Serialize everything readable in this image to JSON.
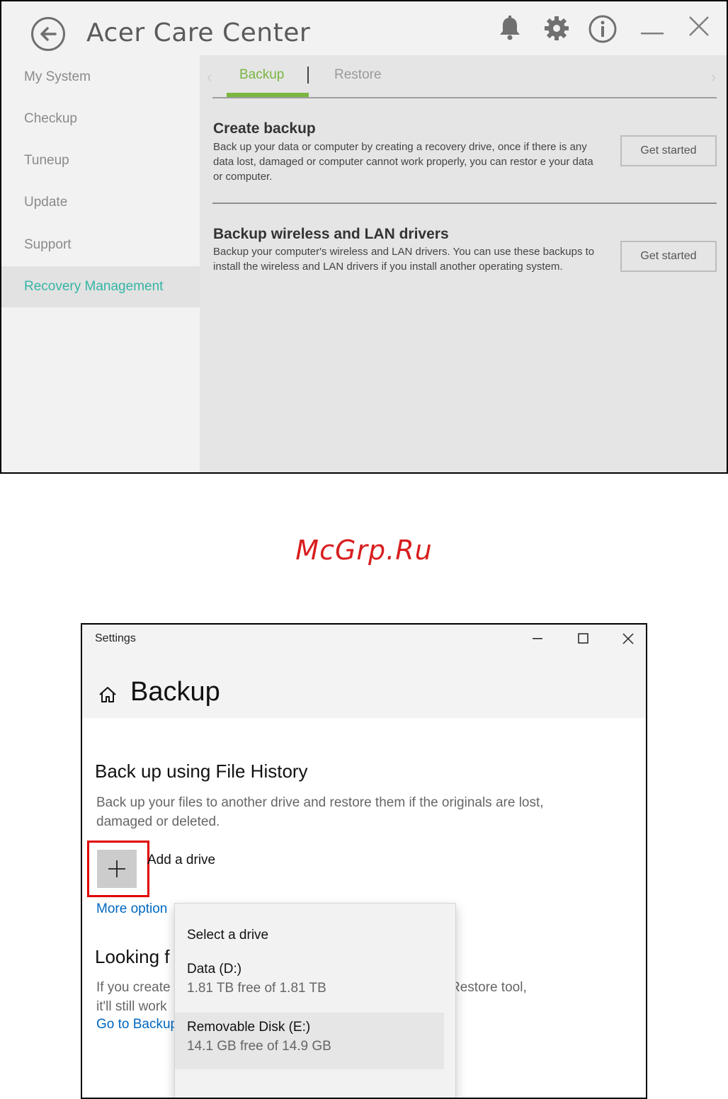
{
  "acer": {
    "title": "Acer Care Center",
    "sidebar": [
      {
        "label": "My System",
        "active": false
      },
      {
        "label": "Checkup",
        "active": false
      },
      {
        "label": "Tuneup",
        "active": false
      },
      {
        "label": "Update",
        "active": false
      },
      {
        "label": "Support",
        "active": false
      },
      {
        "label": "Recovery Management",
        "active": true
      }
    ],
    "tabs": [
      {
        "label": "Backup",
        "active": true
      },
      {
        "label": "Restore",
        "active": false
      }
    ],
    "sections": [
      {
        "title": "Create backup",
        "description": "Back up your data or computer by creating a recovery drive, once if there is  any data lost, damaged or computer cannot work properly, you can restor e your data or computer.",
        "button": "Get started"
      },
      {
        "title": "Backup wireless and LAN drivers",
        "description": "Backup your computer's wireless and LAN drivers. You can use these backups to install the wireless and LAN drivers if you install another operating system.",
        "button": "Get started"
      }
    ],
    "colors": {
      "accent": "#35b5a4",
      "tab_accent": "#7ab640"
    }
  },
  "watermark": "McGrp.Ru",
  "settings": {
    "app_title": "Settings",
    "page_title": "Backup",
    "file_history": {
      "title": "Back up using File History",
      "description": "Back up your files to another drive and restore them if the originals are lost, damaged or deleted.",
      "add_drive_label": "Add a drive",
      "more_options_link": "More option"
    },
    "looking": {
      "title": "Looking f",
      "line1": "If you create",
      "line2": "it'll still work",
      "line1_right": "Restore tool,",
      "link": "Go to Backup"
    },
    "drive_picker": {
      "title": "Select a drive",
      "drives": [
        {
          "name": "Data (D:)",
          "free": "1.81 TB free of 1.81 TB"
        },
        {
          "name": "Removable Disk (E:)",
          "free": "14.1 GB free of 14.9 GB"
        }
      ]
    },
    "colors": {
      "link": "#0067c0",
      "highlight": "#e00000"
    }
  }
}
